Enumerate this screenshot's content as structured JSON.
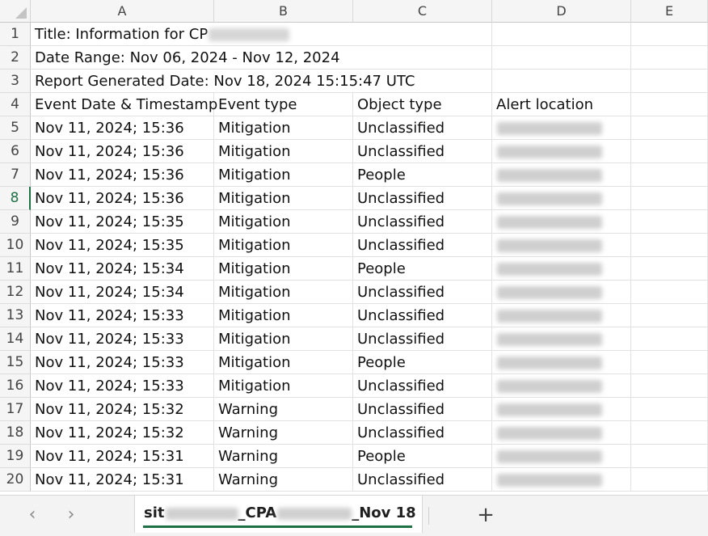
{
  "columns": [
    "A",
    "B",
    "C",
    "D",
    "E"
  ],
  "header_rows": [
    {
      "num": "1",
      "a": "Title: Information for CP"
    },
    {
      "num": "2",
      "a": "Date Range: Nov 06, 2024 - Nov 12, 2024"
    },
    {
      "num": "3",
      "a": "Report Generated Date: Nov 18, 2024 15:15:47 UTC"
    }
  ],
  "table_header": {
    "num": "4",
    "a": "Event Date & Timestamp",
    "b": "Event type",
    "c": "Object type",
    "d": "Alert location"
  },
  "rows": [
    {
      "num": "5",
      "a": "Nov 11, 2024; 15:36",
      "b": "Mitigation",
      "c": "Unclassified"
    },
    {
      "num": "6",
      "a": "Nov 11, 2024; 15:36",
      "b": "Mitigation",
      "c": "Unclassified"
    },
    {
      "num": "7",
      "a": "Nov 11, 2024; 15:36",
      "b": "Mitigation",
      "c": "People"
    },
    {
      "num": "8",
      "a": "Nov 11, 2024; 15:36",
      "b": "Mitigation",
      "c": "Unclassified"
    },
    {
      "num": "9",
      "a": "Nov 11, 2024; 15:35",
      "b": "Mitigation",
      "c": "Unclassified"
    },
    {
      "num": "10",
      "a": "Nov 11, 2024; 15:35",
      "b": "Mitigation",
      "c": "Unclassified"
    },
    {
      "num": "11",
      "a": "Nov 11, 2024; 15:34",
      "b": "Mitigation",
      "c": "People"
    },
    {
      "num": "12",
      "a": "Nov 11, 2024; 15:34",
      "b": "Mitigation",
      "c": "Unclassified"
    },
    {
      "num": "13",
      "a": "Nov 11, 2024; 15:33",
      "b": "Mitigation",
      "c": "Unclassified"
    },
    {
      "num": "14",
      "a": "Nov 11, 2024; 15:33",
      "b": "Mitigation",
      "c": "Unclassified"
    },
    {
      "num": "15",
      "a": "Nov 11, 2024; 15:33",
      "b": "Mitigation",
      "c": "People"
    },
    {
      "num": "16",
      "a": "Nov 11, 2024; 15:33",
      "b": "Mitigation",
      "c": "Unclassified"
    },
    {
      "num": "17",
      "a": "Nov 11, 2024; 15:32",
      "b": "Warning",
      "c": "Unclassified"
    },
    {
      "num": "18",
      "a": "Nov 11, 2024; 15:32",
      "b": "Warning",
      "c": "Unclassified"
    },
    {
      "num": "19",
      "a": "Nov 11, 2024; 15:31",
      "b": "Warning",
      "c": "People"
    },
    {
      "num": "20",
      "a": "Nov 11, 2024; 15:31",
      "b": "Warning",
      "c": "Unclassified"
    }
  ],
  "active_row": "8",
  "sheet_tab": {
    "part1": "sit",
    "part2": "_CPA",
    "part3": "_Nov 18"
  },
  "tabbar": {
    "prev_icon": "chevron-left-icon",
    "next_icon": "chevron-right-icon",
    "add_label": "+"
  },
  "colors": {
    "accent": "#1e7145",
    "header_bg": "#f5f5f5",
    "gridline": "#e1e1e1"
  }
}
